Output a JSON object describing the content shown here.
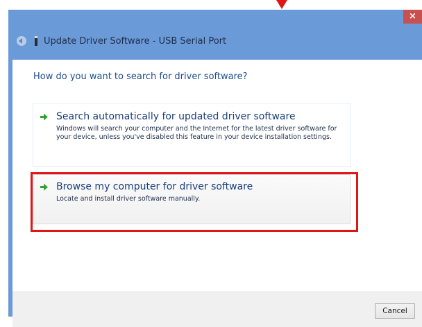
{
  "window": {
    "title": "Update Driver Software - USB Serial Port",
    "close_glyph": "×"
  },
  "content": {
    "question": "How do you want to search for driver software?",
    "options": [
      {
        "title": "Search automatically for updated driver software",
        "description": "Windows will search your computer and the Internet for the latest driver software for your device, unless you've disabled this feature in your device installation settings."
      },
      {
        "title": "Browse my computer for driver software",
        "description": "Locate and install driver software manually."
      }
    ]
  },
  "footer": {
    "cancel_label": "Cancel"
  },
  "icons": {
    "option_arrow": "green-arrow-icon",
    "back": "back-arrow-icon",
    "device": "usb-device-icon",
    "close": "close-icon"
  },
  "colors": {
    "titlebar": "#6b9ad8",
    "close_button": "#c75050",
    "option_title": "#1c3f7a",
    "option_arrow": "#2fa32f",
    "annotation_red": "#e01515"
  }
}
